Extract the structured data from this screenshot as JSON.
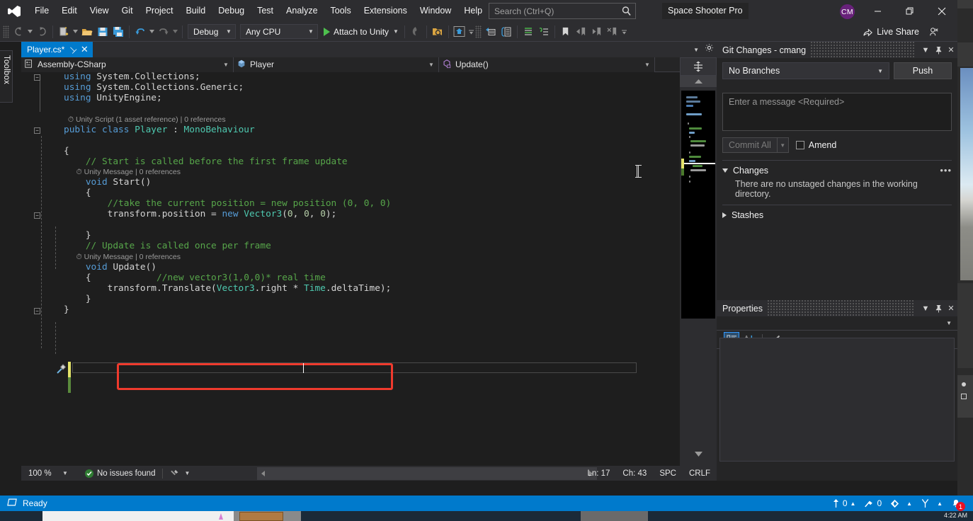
{
  "app": {
    "logo_name": "visual-studio-logo",
    "solution_title": "Space Shooter Pro",
    "avatar_initials": "CM"
  },
  "menu": {
    "items": [
      "File",
      "Edit",
      "View",
      "Git",
      "Project",
      "Build",
      "Debug",
      "Test",
      "Analyze",
      "Tools",
      "Extensions",
      "Window",
      "Help"
    ]
  },
  "search": {
    "placeholder": "Search (Ctrl+Q)",
    "icon": "magnifier-icon"
  },
  "window_controls": {
    "minimize": "minimize-icon",
    "restore": "restore-icon",
    "close": "close-icon"
  },
  "toolbar": {
    "back": "navigate-back-icon",
    "forward": "navigate-forward-icon",
    "new_project": "new-project-icon",
    "open": "open-file-icon",
    "save": "save-icon",
    "save_all": "save-all-icon",
    "undo": "undo-icon",
    "redo": "redo-icon",
    "configuration": "Debug",
    "platform": "Any CPU",
    "start_label": "Attach to Unity",
    "hot_reload": "hot-reload-icon",
    "search_tool": "find-in-files-icon",
    "home": "solution-home-icon",
    "live_share_label": "Live Share",
    "pin": "pin-toolbar-icon"
  },
  "toolbox": {
    "label": "Toolbox"
  },
  "editor": {
    "tab_label": "Player.cs*",
    "tab_pin_icon": "pin-icon",
    "tab_close_icon": "close-icon",
    "tabstrip_dropdown": "chevron-down-icon",
    "tabstrip_settings": "gear-icon",
    "breadcrumb": {
      "project": "Assembly-CSharp",
      "type": "Player",
      "member": "Update()"
    },
    "caret_line_text": "//new vector3(1,0,0)* real time",
    "code_lines": [
      {
        "indent": 0,
        "tokens": [
          {
            "t": "using ",
            "c": "kw"
          },
          {
            "t": "System.Collections;",
            "c": "plain"
          }
        ]
      },
      {
        "indent": 0,
        "tokens": [
          {
            "t": "using ",
            "c": "kw"
          },
          {
            "t": "System.Collections.Generic;",
            "c": "plain"
          }
        ]
      },
      {
        "indent": 0,
        "tokens": [
          {
            "t": "using ",
            "c": "kw"
          },
          {
            "t": "UnityEngine;",
            "c": "plain"
          }
        ]
      },
      {
        "indent": 0,
        "tokens": []
      },
      {
        "indent": 0,
        "tokens": [
          {
            "t": "CODELENS:Unity Script (1 asset reference) | 0 references",
            "c": "cref"
          }
        ]
      },
      {
        "indent": 0,
        "tokens": [
          {
            "t": "public ",
            "c": "kw"
          },
          {
            "t": "class ",
            "c": "kw"
          },
          {
            "t": "Player",
            "c": "cls"
          },
          {
            "t": " : ",
            "c": "plain"
          },
          {
            "t": "MonoBehaviour",
            "c": "cls"
          }
        ]
      },
      {
        "indent": 0,
        "tokens": []
      },
      {
        "indent": 0,
        "tokens": [
          {
            "t": "{",
            "c": "plain"
          }
        ]
      },
      {
        "indent": 1,
        "tokens": [
          {
            "t": "// Start is called before the first frame update",
            "c": "cmt"
          }
        ]
      },
      {
        "indent": 1,
        "tokens": [
          {
            "t": "CODELENS:Unity Message | 0 references",
            "c": "cref"
          }
        ]
      },
      {
        "indent": 1,
        "tokens": [
          {
            "t": "void ",
            "c": "kw"
          },
          {
            "t": "Start",
            "c": "plain"
          },
          {
            "t": "()",
            "c": "plain"
          }
        ]
      },
      {
        "indent": 1,
        "tokens": [
          {
            "t": "{",
            "c": "plain"
          }
        ]
      },
      {
        "indent": 2,
        "tokens": [
          {
            "t": "//take the current position = new position (0, 0, 0)",
            "c": "cmt"
          }
        ]
      },
      {
        "indent": 2,
        "tokens": [
          {
            "t": "transform",
            "c": "plain"
          },
          {
            "t": ".position = ",
            "c": "plain"
          },
          {
            "t": "new ",
            "c": "kw"
          },
          {
            "t": "Vector3",
            "c": "cls"
          },
          {
            "t": "(",
            "c": "plain"
          },
          {
            "t": "0",
            "c": "num"
          },
          {
            "t": ", ",
            "c": "plain"
          },
          {
            "t": "0",
            "c": "num"
          },
          {
            "t": ", ",
            "c": "plain"
          },
          {
            "t": "0",
            "c": "num"
          },
          {
            "t": ");",
            "c": "plain"
          }
        ]
      },
      {
        "indent": 1,
        "tokens": []
      },
      {
        "indent": 1,
        "tokens": [
          {
            "t": "}",
            "c": "plain"
          }
        ]
      },
      {
        "indent": 1,
        "tokens": [
          {
            "t": "// Update is called once per frame",
            "c": "cmt"
          }
        ]
      },
      {
        "indent": 1,
        "tokens": [
          {
            "t": "CODELENS:Unity Message | 0 references",
            "c": "cref"
          }
        ]
      },
      {
        "indent": 1,
        "tokens": [
          {
            "t": "void ",
            "c": "kw"
          },
          {
            "t": "Update",
            "c": "plain"
          },
          {
            "t": "()",
            "c": "plain"
          }
        ]
      },
      {
        "indent": 1,
        "tokens": [
          {
            "t": "{",
            "c": "plain"
          },
          {
            "t": "            ",
            "c": "plain"
          },
          {
            "t": "//new vector3(1,0,0)* real time",
            "c": "cmt"
          }
        ]
      },
      {
        "indent": 2,
        "tokens": [
          {
            "t": "transform",
            "c": "plain"
          },
          {
            "t": ".Translate(",
            "c": "plain"
          },
          {
            "t": "Vector3",
            "c": "cls"
          },
          {
            "t": ".right ",
            "c": "plain"
          },
          {
            "t": "* ",
            "c": "plain"
          },
          {
            "t": "Time",
            "c": "cls"
          },
          {
            "t": ".deltaTime);",
            "c": "plain"
          }
        ]
      },
      {
        "indent": 1,
        "tokens": [
          {
            "t": "}",
            "c": "plain"
          }
        ]
      },
      {
        "indent": 0,
        "tokens": [
          {
            "t": "}",
            "c": "plain"
          }
        ]
      }
    ],
    "status": {
      "zoom": "100 %",
      "issues": "No issues found",
      "issues_icon": "check-circle-icon",
      "filter_icon": "issue-filter-icon",
      "line": "Ln: 17",
      "column": "Ch: 43",
      "spaces": "SPC",
      "line_endings": "CRLF"
    }
  },
  "minimap": {
    "split_icon": "split-view-icon",
    "scroll_up_icon": "chevron-up-icon",
    "scroll_down_icon": "chevron-down-icon"
  },
  "git_panel": {
    "title": "Git Changes - cmang",
    "dropdown_icon": "chevron-down-icon",
    "pin_icon": "pin-icon",
    "close_icon": "close-icon",
    "branch": "No Branches",
    "push_label": "Push",
    "message_placeholder": "Enter a message <Required>",
    "commit_all_label": "Commit All",
    "amend_label": "Amend",
    "changes_label": "Changes",
    "changes_overflow": "•••",
    "changes_note": "There are no unstaged changes in the working directory.",
    "stashes_label": "Stashes"
  },
  "properties_panel": {
    "title": "Properties",
    "dropdown_icon": "chevron-down-icon",
    "pin_icon": "pin-icon",
    "close_icon": "close-icon",
    "categorized_icon": "categorized-view-icon",
    "alphabetical_icon": "alphabetical-sort-icon",
    "property_pages_icon": "property-pages-icon"
  },
  "app_status_bar": {
    "ready_label": "Ready",
    "ready_icon": "source-control-icon",
    "outgoing_count": "0",
    "outgoing_icon": "arrow-up-icon",
    "pending_count": "0",
    "pending_icon": "pencil-icon",
    "repo_icon": "repository-icon",
    "branch_icon": "branch-icon",
    "notifications_icon": "bell-icon",
    "notifications_count": "1"
  },
  "taskbar": {
    "clock": "4:22 AM"
  },
  "colors": {
    "accent": "#007acc",
    "panel": "#252526",
    "chrome": "#2d2d30",
    "editor_bg": "#1e1e1e",
    "comment": "#57a64a",
    "keyword": "#569cd6",
    "type": "#4ec9b0",
    "number": "#b5cea8",
    "highlight_box": "#ef3a2d",
    "avatar": "#68217a"
  }
}
